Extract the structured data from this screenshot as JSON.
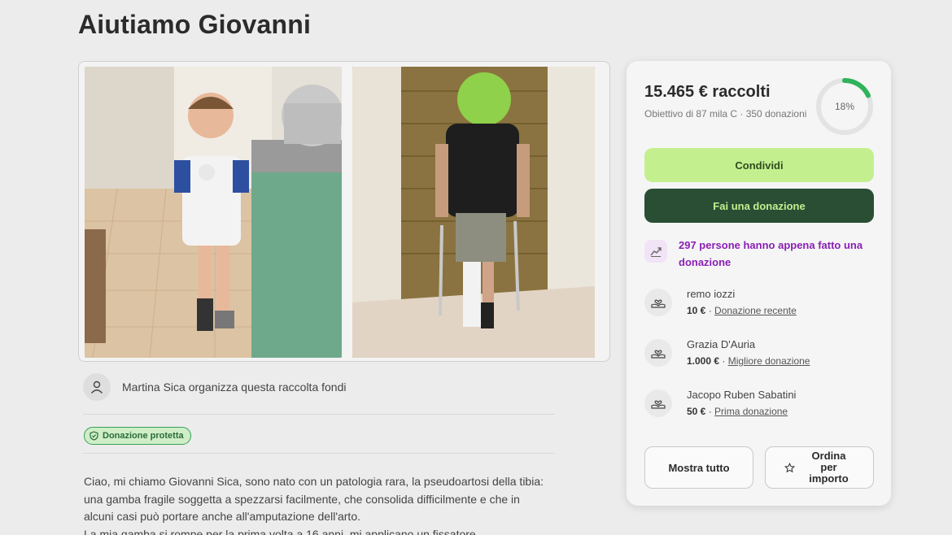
{
  "page_title": "Aiutiamo Giovanni",
  "organizer": {
    "text": "Martina Sica organizza questa raccolta fondi"
  },
  "badge": {
    "label": "Donazione protetta"
  },
  "story": {
    "lines": [
      "Ciao, mi chiamo Giovanni Sica, sono nato con un patologia rara, la pseudoartosi della tibia:",
      "una gamba fragile soggetta a spezzarsi facilmente, che consolida difficilmente e che in",
      "alcuni casi può portare anche all'amputazione dell'arto.",
      "La mia gamba si rompe per la prima volta a 16 anni, mi applicano un fissatore"
    ]
  },
  "donation_card": {
    "raised": "15.465 € raccolti",
    "goal_text": "Obiettivo di 87 mila C · 350 donazioni",
    "progress_label": "18%",
    "progress_fraction": 0.18,
    "share_label": "Condividi",
    "donate_label": "Fai una donazione",
    "recent_activity": "297 persone hanno appena fatto una donazione",
    "donors": [
      {
        "name": "remo iozzi",
        "amount": "10 €",
        "tag": "Donazione recente"
      },
      {
        "name": "Grazia D'Auria",
        "amount": "1.000 €",
        "tag": "Migliore donazione"
      },
      {
        "name": "Jacopo Ruben Sabatini",
        "amount": "50 €",
        "tag": "Prima donazione"
      }
    ],
    "show_all_label": "Mostra tutto",
    "sort_label": "Ordina per importo"
  },
  "colors": {
    "accent_green": "#c4ef8f",
    "dark_green": "#2a4e34",
    "purple": "#8a1fb5",
    "ring_green": "#2fb35a"
  },
  "icons": {
    "organizer": "person-icon",
    "badge": "shield-icon",
    "recent": "trending-up-icon",
    "donor": "heart-hands-icon",
    "sort": "star-icon"
  }
}
